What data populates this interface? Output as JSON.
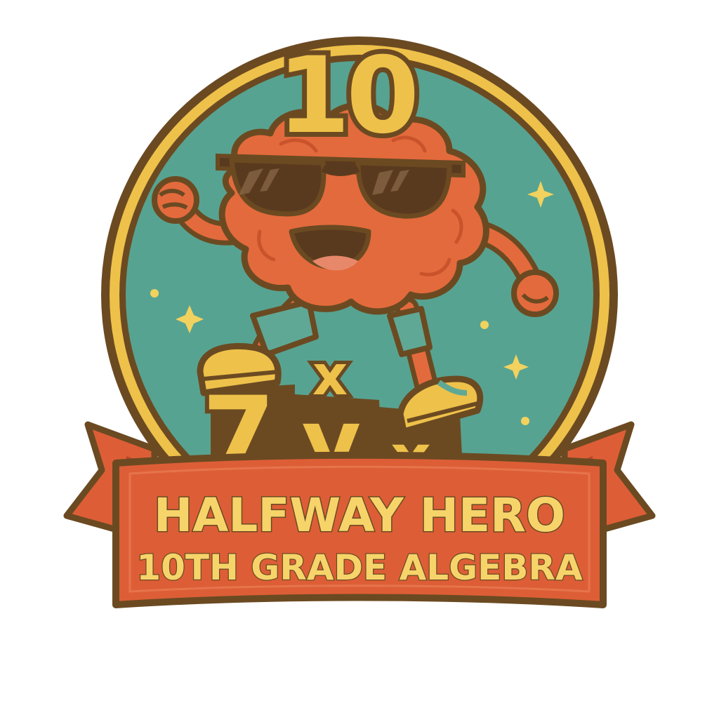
{
  "badge": {
    "number": "10",
    "title": "HALFWAY HERO",
    "subtitle": "10TH GRADE ALGEBRA",
    "blocks": {
      "seven": "7",
      "y": "y",
      "x_top": "x",
      "x_bottom": "x"
    },
    "mascot": "brain-mascot-with-sunglasses"
  },
  "colors": {
    "outline": "#6b4a22",
    "gold": "#eec14a",
    "teal": "#57a391",
    "brain": "#e36a3c",
    "brain_shadow": "#c9532b",
    "ribbon": "#dd5e36",
    "ribbon_text": "#f6d46a",
    "glasses": "#5a3a1e",
    "sparkle": "#f2d25e",
    "shirt": "#5fa895",
    "shoe": "#eec14a"
  }
}
